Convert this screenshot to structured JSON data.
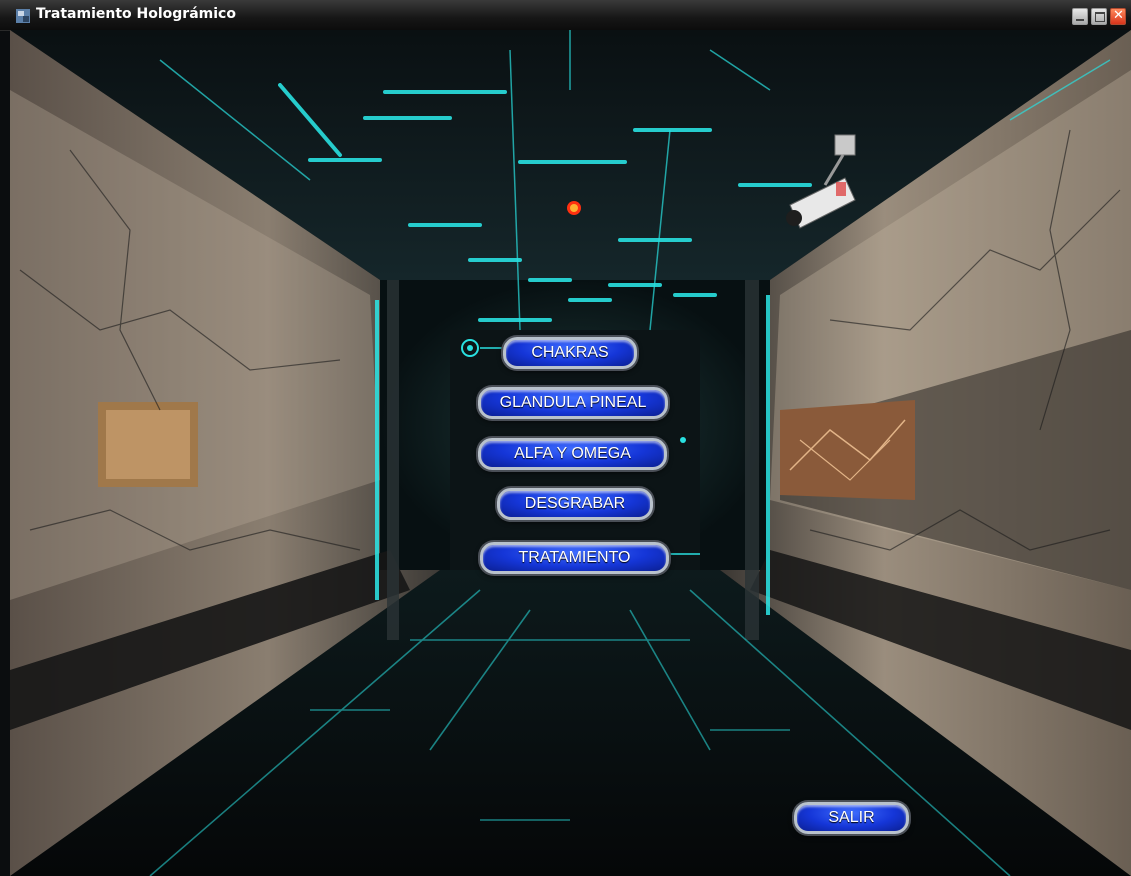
{
  "window": {
    "title": "Tratamiento Holográmico",
    "icons": [
      "app-icon",
      "minimize-icon",
      "maximize-icon",
      "close-icon"
    ]
  },
  "menu": {
    "chakras": "CHAKRAS",
    "glandula_pineal": "GLANDULA PINEAL",
    "alfa_y_omega": "ALFA Y OMEGA",
    "desgrabar": "DESGRABAR",
    "tratamiento": "TRATAMIENTO"
  },
  "exit_label": "SALIR",
  "colors": {
    "button_blue": "#1536d8",
    "neon_cyan": "#29e0e0",
    "titlebar": "#161616"
  }
}
